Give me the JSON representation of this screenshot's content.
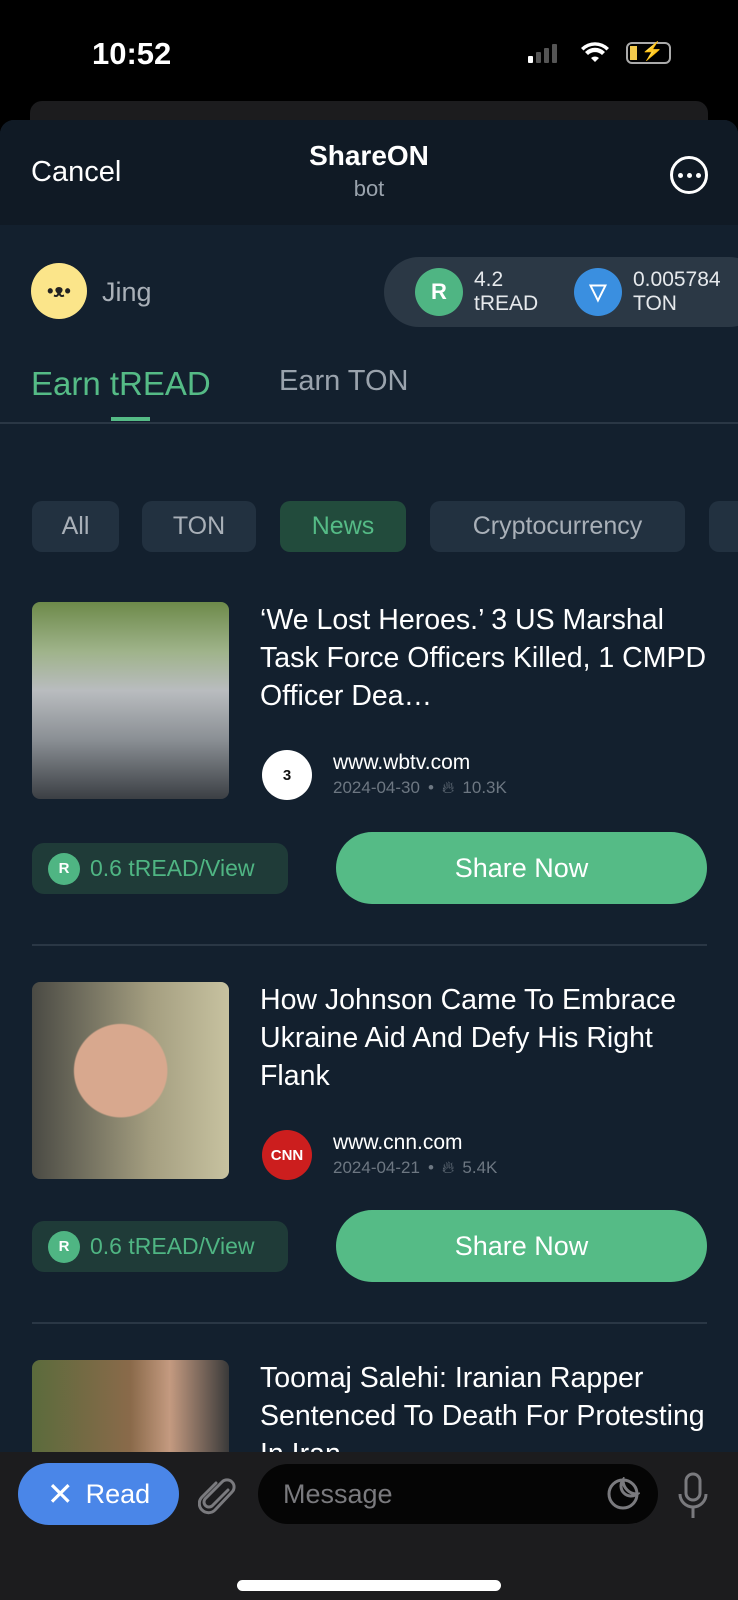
{
  "status_bar": {
    "time": "10:52",
    "icons": [
      "signal-icon",
      "wifi-icon",
      "battery-charging-icon"
    ]
  },
  "header": {
    "cancel_label": "Cancel",
    "title": "ShareON",
    "subtitle": "bot",
    "more_icon": "more-icon"
  },
  "user": {
    "name": "Jing"
  },
  "balances": [
    {
      "amount": "4.2",
      "unit": "tREAD",
      "icon": "tread-coin-icon"
    },
    {
      "amount": "0.005784",
      "unit": "TON",
      "icon": "ton-coin-icon"
    }
  ],
  "tabs": [
    {
      "label": "Earn tREAD",
      "active": true
    },
    {
      "label": "Earn TON",
      "active": false
    }
  ],
  "filters": [
    {
      "label": "All"
    },
    {
      "label": "TON"
    },
    {
      "label": "News",
      "active": true
    },
    {
      "label": "Cryptocurrency"
    }
  ],
  "articles": [
    {
      "title": "‘We Lost Heroes.’ 3 US Marshal Task Force Officers Killed, 1 CMPD Officer Dea…",
      "source": "www.wbtv.com",
      "date": "2024-04-30",
      "views": "10.3K",
      "reward": "0.6 tREAD/View",
      "share_label": "Share Now"
    },
    {
      "title": "How Johnson Came To Embrace Ukraine Aid And Defy His Right Flank",
      "source": "www.cnn.com",
      "date": "2024-04-21",
      "views": "5.4K",
      "reward": "0.6 tREAD/View",
      "share_label": "Share Now"
    },
    {
      "title": "Toomaj Salehi: Iranian Rapper Sentenced To Death For Protesting In Iran"
    }
  ],
  "bottom_bar": {
    "read_label": "Read",
    "message_placeholder": "Message"
  },
  "colors": {
    "accent": "#55bb86",
    "background": "#13202e",
    "read_button": "#4a86e8"
  }
}
